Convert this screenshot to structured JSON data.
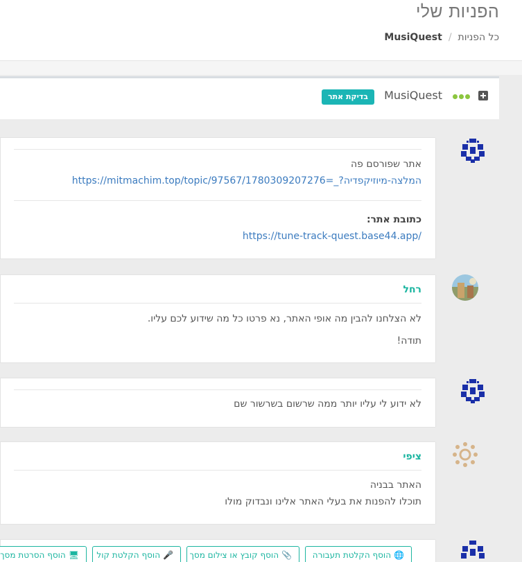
{
  "header": {
    "title": "הפניות שלי",
    "breadcrumb": {
      "root": "כל הפניות",
      "separator": "/",
      "current": "MusiQuest"
    }
  },
  "ticket": {
    "name": "MusiQuest",
    "status": "בדיקת אתר",
    "status_color": "#1bb5b5"
  },
  "messages": [
    {
      "author": "",
      "line1": "אתר שפורסם פה",
      "link1": "https://mitmachim.top/topic/97567/1780309207276=_?המלצה-מיוזיקפדיה",
      "label": "כתובת אתר:",
      "link2": "https://tune-track-quest.base44.app/"
    },
    {
      "author": "רחל",
      "line1": "לא הצלחנו להבין מה אופי האתר, נא פרטו כל מה שידוע לכם עליו.",
      "line2": "תודה!"
    },
    {
      "author": "",
      "line1": "לא ידוע לי עליו יותר ממה שרשום בשרשור שם"
    },
    {
      "author": "ציפי",
      "line1": "האתר בבניה",
      "line2": "תוכלו להפנות את בעלי האתר אלינו ונבדוק מולו"
    }
  ],
  "actions": {
    "add_recording": "הוסף הקלטת תעבורה",
    "add_file": "הוסף קובץ או צילום מסך",
    "add_voice": "הוסף הקלטת קול",
    "add_screen": "הוסף הסרטת מסך"
  },
  "colors": {
    "accent": "#1bb5a0",
    "link": "#3b7bbf",
    "dots": "#8cc63f"
  }
}
